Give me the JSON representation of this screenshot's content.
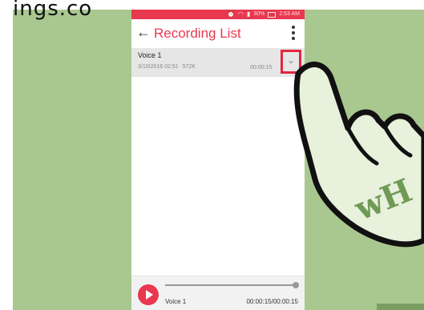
{
  "caption": "ings.co",
  "status_bar": {
    "battery": "30%",
    "time": "2:53 AM"
  },
  "app_bar": {
    "back_glyph": "←",
    "title": "Recording List"
  },
  "recordings": [
    {
      "name": "Voice 1",
      "date": "3/10/2016 02:51",
      "size": "572K",
      "duration": "00:00:15"
    }
  ],
  "player": {
    "track_name": "Voice 1",
    "time": "00:00:15/00:00:15",
    "progress": 1.0
  },
  "watermark": {
    "logo_text": "wH"
  },
  "colors": {
    "accent": "#e8384f",
    "highlight_box": "#e0283f",
    "background": "#a9c890"
  }
}
